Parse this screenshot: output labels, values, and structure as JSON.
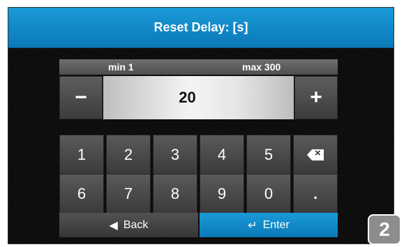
{
  "header": {
    "title": "Reset Delay: [s]"
  },
  "range": {
    "min_label": "min 1",
    "max_label": "max 300"
  },
  "value": {
    "current": "20",
    "minus_label": "−",
    "plus_label": "+"
  },
  "keypad": {
    "row1": [
      "1",
      "2",
      "3",
      "4",
      "5"
    ],
    "row2": [
      "6",
      "7",
      "8",
      "9",
      "0",
      "."
    ],
    "backspace_icon": "backspace-icon"
  },
  "footer": {
    "back_label": "Back",
    "enter_label": "Enter",
    "back_icon": "arrow-left-icon",
    "enter_icon": "return-icon"
  },
  "badge": {
    "label": "2"
  },
  "colors": {
    "accent": "#0b79b8",
    "header": "#1a9ad7",
    "key": "#4a4a4a"
  }
}
